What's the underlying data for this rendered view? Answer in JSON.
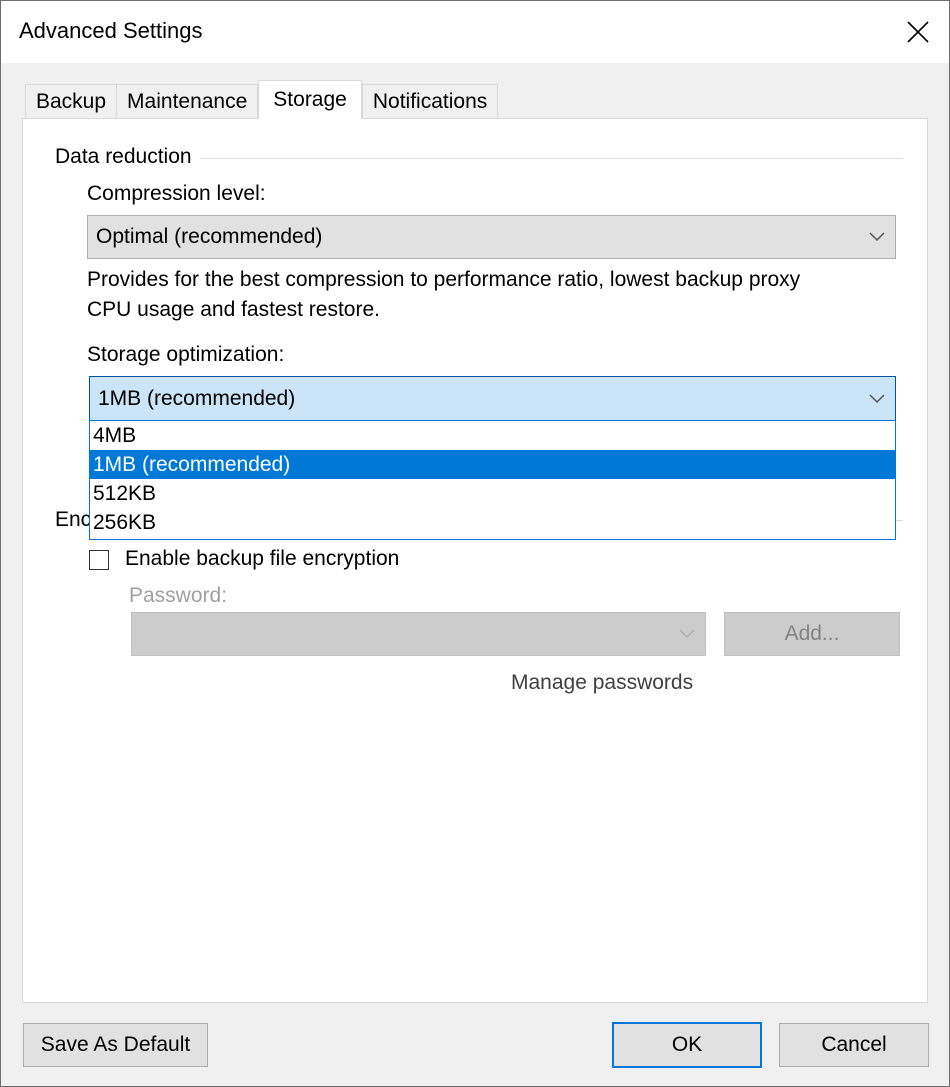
{
  "window": {
    "title": "Advanced Settings",
    "close_icon": "close-icon"
  },
  "tabs": [
    {
      "label": "Backup",
      "active": false
    },
    {
      "label": "Maintenance",
      "active": false
    },
    {
      "label": "Storage",
      "active": true
    },
    {
      "label": "Notifications",
      "active": false
    }
  ],
  "data_reduction": {
    "group_title": "Data reduction",
    "compression_label": "Compression level:",
    "compression_value": "Optimal (recommended)",
    "compression_description_line1": "Provides for the best compression to performance ratio, lowest backup proxy",
    "compression_description_line2": "CPU usage and fastest restore.",
    "storage_optimization_label": "Storage optimization:",
    "storage_optimization_value": "1MB (recommended)",
    "storage_optimization_options": [
      "4MB",
      "1MB (recommended)",
      "512KB",
      "256KB"
    ],
    "storage_optimization_selected_index": 1
  },
  "encryption": {
    "group_title_partial": "Enc",
    "group_title": "Encryption",
    "enable_label": "Enable backup file encryption",
    "enabled": false,
    "password_label": "Password:",
    "password_value": "",
    "add_button": "Add...",
    "manage_passwords": "Manage passwords"
  },
  "footer": {
    "save_default": "Save As Default",
    "ok": "OK",
    "cancel": "Cancel"
  },
  "colors": {
    "accent": "#0078d7",
    "focus_fill": "#cce4f7",
    "window_bg": "#f0f0f0"
  }
}
